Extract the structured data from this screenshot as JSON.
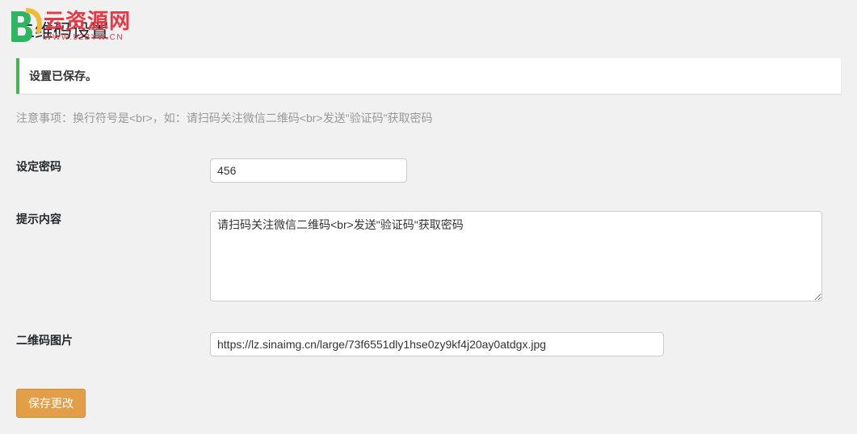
{
  "logo": {
    "main_text": "云资源网",
    "sub_text": "WWW.52BYW.CN"
  },
  "page": {
    "title": "二维码设置"
  },
  "notice": {
    "message": "设置已保存。"
  },
  "note": {
    "text": "注意事项：换行符号是<br>，如：请扫码关注微信二维码<br>发送\"验证码\"获取密码"
  },
  "fields": {
    "password": {
      "label": "设定密码",
      "value": "456"
    },
    "hint": {
      "label": "提示内容",
      "value": "请扫码关注微信二维码<br>发送\"验证码\"获取密码"
    },
    "qrcode_image": {
      "label": "二维码图片",
      "value": "https://lz.sinaimg.cn/large/73f6551dly1hse0zy9kf4j20ay0atdgx.jpg"
    }
  },
  "actions": {
    "save_label": "保存更改"
  }
}
